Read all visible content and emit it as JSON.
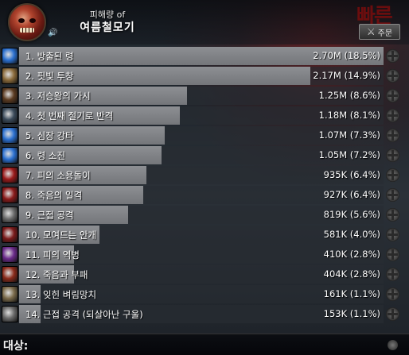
{
  "header": {
    "subtitle": "피해량 of",
    "title": "여름철모기",
    "spec_button_label": "주문",
    "backdrop_text": "빠른"
  },
  "rows": [
    {
      "name": "1. 방출된 령",
      "value": "2.70M (18.5%)",
      "fill": 1.0,
      "icon_color": "#2a6fd0"
    },
    {
      "name": "2. 핏빛 투창",
      "value": "2.17M (14.9%)",
      "fill": 0.8,
      "icon_color": "#8a6a3a"
    },
    {
      "name": "3. 저승왕의 가시",
      "value": "1.25M (8.6%)",
      "fill": 0.46,
      "icon_color": "#5a3a20"
    },
    {
      "name": "4. 첫 번째 절기로 반격",
      "value": "1.18M (8.1%)",
      "fill": 0.44,
      "icon_color": "#3a4a5a"
    },
    {
      "name": "5. 심장 강타",
      "value": "1.07M (7.3%)",
      "fill": 0.4,
      "icon_color": "#2a6fd0"
    },
    {
      "name": "6. 령 소진",
      "value": "1.05M (7.2%)",
      "fill": 0.39,
      "icon_color": "#2a6fd0"
    },
    {
      "name": "7. 피의 소용돌이",
      "value": "935K (6.4%)",
      "fill": 0.35,
      "icon_color": "#9a1a1a"
    },
    {
      "name": "8. 죽음의 일격",
      "value": "927K (6.4%)",
      "fill": 0.34,
      "icon_color": "#8a1a1a"
    },
    {
      "name": "9. 근접 공격",
      "value": "819K (5.6%)",
      "fill": 0.3,
      "icon_color": "#6a6a6a"
    },
    {
      "name": "10. 모여드는 안개",
      "value": "581K (4.0%)",
      "fill": 0.22,
      "icon_color": "#7a1a1a"
    },
    {
      "name": "11. 피의 역병",
      "value": "410K (2.8%)",
      "fill": 0.15,
      "icon_color": "#6a2a8a"
    },
    {
      "name": "12. 죽음과 부패",
      "value": "404K (2.8%)",
      "fill": 0.15,
      "icon_color": "#8a2a1a"
    },
    {
      "name": "13. 잊힌 벼림망치",
      "value": "161K (1.1%)",
      "fill": 0.06,
      "icon_color": "#7a6a4a"
    },
    {
      "name": "14. 근접 공격 (되살아난 구울)",
      "value": "153K (1.1%)",
      "fill": 0.06,
      "icon_color": "#6a6a6a"
    }
  ],
  "footer": {
    "target_label": "대상:"
  }
}
